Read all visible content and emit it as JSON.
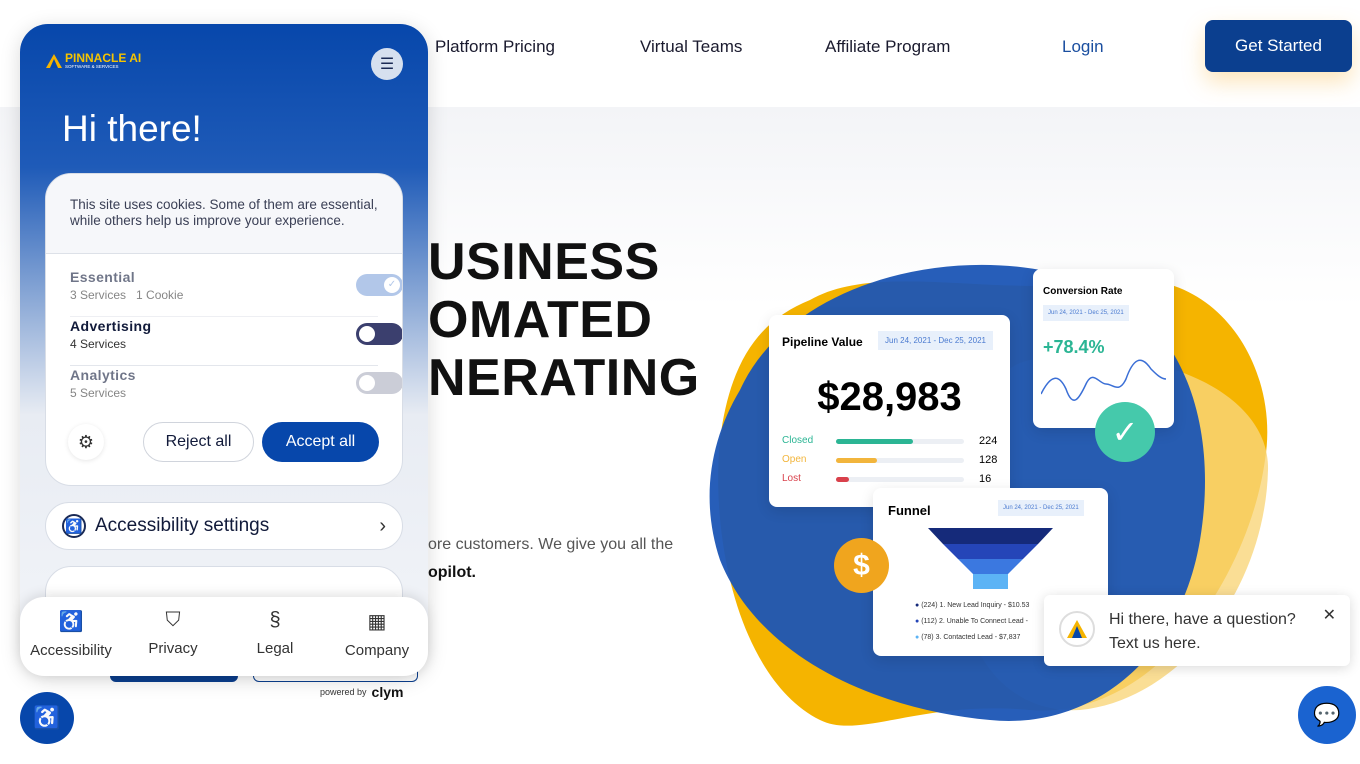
{
  "nav": {
    "items": [
      "Platform Pricing",
      "Virtual Teams",
      "Affiliate Program"
    ],
    "login": "Login",
    "get_started": "Get Started"
  },
  "hero": {
    "lines": [
      "USINESS",
      "OMATED",
      "NERATING"
    ],
    "sub1": "ore customers. We give you all the",
    "sub2": "opilot."
  },
  "illustration": {
    "pipeline_title": "Pipeline Value",
    "pipeline_range": "Jun 24, 2021 - Dec 25, 2021",
    "pipeline_value": "$28,983",
    "rows": [
      {
        "label": "Closed",
        "value": "224",
        "fill": 0.6,
        "color": "#2bb594"
      },
      {
        "label": "Open",
        "value": "128",
        "fill": 0.32,
        "color": "#f2b53c"
      },
      {
        "label": "Lost",
        "value": "16",
        "fill": 0.1,
        "color": "#d9414b"
      }
    ],
    "conv_title": "Conversion Rate",
    "conv_range": "Jun 24, 2021 - Dec 25, 2021",
    "conv_value": "+78.4%",
    "funnel_title": "Funnel",
    "funnel_range": "Jun 24, 2021 - Dec 25, 2021",
    "funnel_items": [
      "(224) 1. New Lead Inquiry - $10.53",
      "(112) 2. Unable To Connect Lead -",
      "(78) 3. Contacted Lead - $7,837"
    ]
  },
  "consent": {
    "logo": "PINNACLE AI",
    "logo_sub": "SOFTWARE & SERVICES",
    "greeting": "Hi there!",
    "message": "This site uses cookies. Some of them are essential, while others help us improve your experience.",
    "categories": [
      {
        "name": "Essential",
        "detail": "3 Services   1 Cookie",
        "state": "on-locked"
      },
      {
        "name": "Advertising",
        "detail": "4 Services",
        "state": "off"
      },
      {
        "name": "Analytics",
        "detail": "5 Services",
        "state": "off"
      }
    ],
    "reject": "Reject all",
    "accept": "Accept all",
    "accessibility_settings": "Accessibility settings",
    "bottom_nav": [
      "Accessibility",
      "Privacy",
      "Legal",
      "Company"
    ],
    "powered_by": "powered by",
    "powered_brand": "clym"
  },
  "chat": {
    "line1": "Hi there, have a question?",
    "line2": "Text us here."
  },
  "colors": {
    "brand": "#0747ab",
    "accent": "#f5b400"
  }
}
